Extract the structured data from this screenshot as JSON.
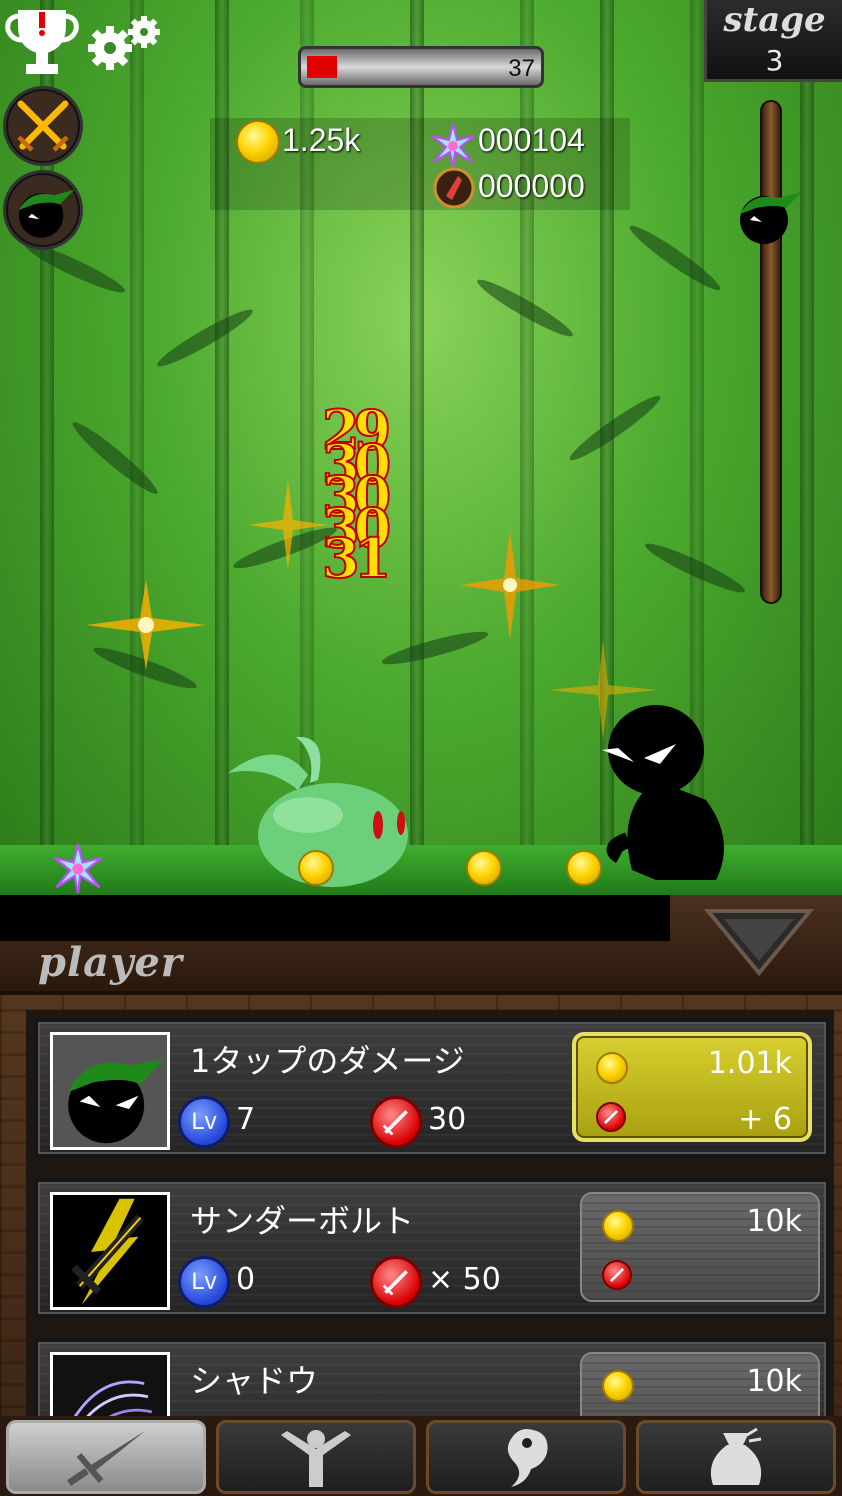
{
  "hud": {
    "enemy_hp": "37",
    "enemy_hp_fraction": 0.13,
    "gold": "1.25k",
    "gems": "000104",
    "relics": "000000",
    "stage_label": "stage",
    "stage_number": "3"
  },
  "damage_popups": [
    "29",
    "30",
    "30",
    "30",
    "31"
  ],
  "panel": {
    "title": "player"
  },
  "upgrades": [
    {
      "name": "1タップのダメージ",
      "level": "7",
      "attack": "30",
      "cost": "1.01k",
      "gain": "+ 6",
      "affordable": true,
      "icon": "ninja-portrait-icon"
    },
    {
      "name": "サンダーボルト",
      "level": "0",
      "attack": "× 50",
      "cost": "10k",
      "gain": "",
      "affordable": false,
      "icon": "thunder-sword-icon"
    },
    {
      "name": "シャドウ",
      "level": "",
      "attack": "",
      "cost": "10k",
      "gain": "",
      "affordable": false,
      "icon": "shadow-claw-icon"
    }
  ],
  "labels": {
    "lv": "Lv"
  },
  "nav": [
    {
      "name": "sword-icon",
      "active": true
    },
    {
      "name": "hero-icon",
      "active": false
    },
    {
      "name": "magatama-icon",
      "active": false
    },
    {
      "name": "bag-icon",
      "active": false
    }
  ],
  "colors": {
    "hp": "#e00000",
    "affordable": "#d8d030",
    "lv": "#2446d8",
    "attack": "#d80000"
  }
}
